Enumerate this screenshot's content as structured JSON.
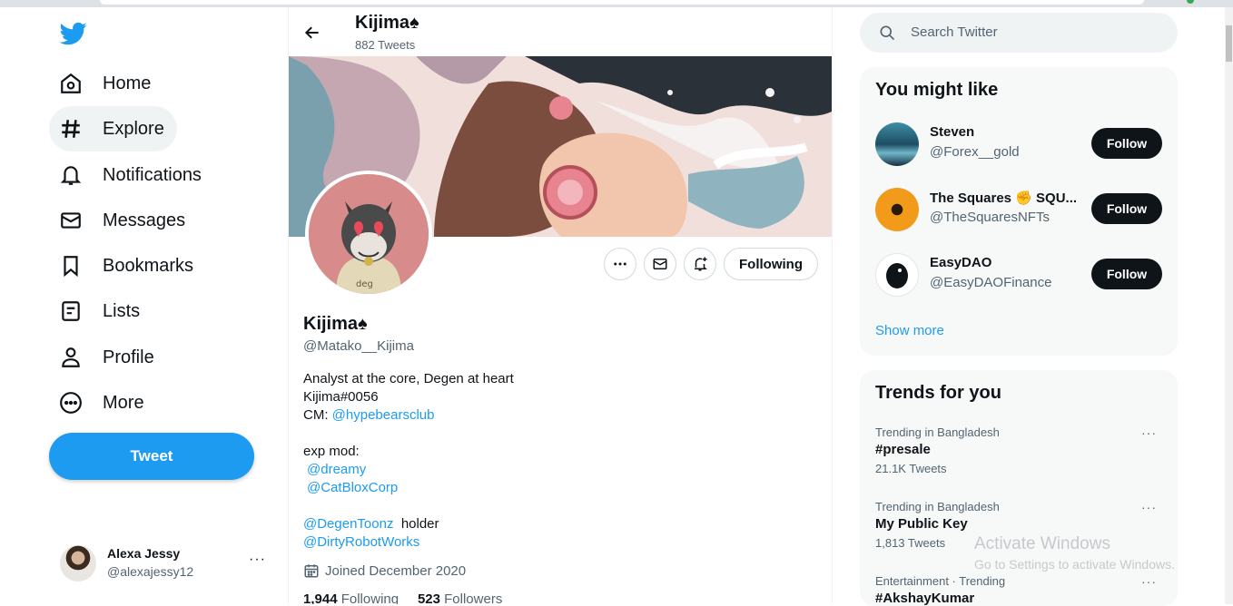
{
  "nav": {
    "items": [
      {
        "label": "Home",
        "icon": "home-icon"
      },
      {
        "label": "Explore",
        "icon": "hashtag-icon"
      },
      {
        "label": "Notifications",
        "icon": "bell-icon"
      },
      {
        "label": "Messages",
        "icon": "envelope-icon"
      },
      {
        "label": "Bookmarks",
        "icon": "bookmark-icon"
      },
      {
        "label": "Lists",
        "icon": "list-icon"
      },
      {
        "label": "Profile",
        "icon": "person-icon"
      },
      {
        "label": "More",
        "icon": "more-circle-icon"
      }
    ],
    "active": "Explore",
    "tweet_label": "Tweet"
  },
  "account": {
    "name": "Alexa Jessy",
    "handle": "@alexajessy12",
    "more": "···"
  },
  "profile_header": {
    "name": "Kijima♠",
    "tweet_count": "882 Tweets"
  },
  "profile": {
    "name": "Kijima♠",
    "handle": "@Matako__Kijima",
    "following_label": "Following",
    "bio": {
      "line1": "Analyst at the core, Degen at heart",
      "line2": "Kijima#0056",
      "line3_prefix": "CM: ",
      "line3_link": "@hypebearsclub",
      "line4": "exp mod:",
      "link_dreamy": "@dreamy",
      "link_catblox": "@CatBloxCorp",
      "link_degentoonz": "@DegenToonz",
      "degentoonz_suffix": "holder",
      "link_dirtyrobot": "@DirtyRobotWorks"
    },
    "joined": "Joined December 2020",
    "following_count": "1,944",
    "following_word": "Following",
    "followers_count": "523",
    "followers_word": "Followers"
  },
  "search": {
    "placeholder": "Search Twitter"
  },
  "suggestions": {
    "title": "You might like",
    "items": [
      {
        "name": "Steven",
        "handle": "@Forex__gold",
        "button": "Follow"
      },
      {
        "name": "The Squares ✊ SQU...",
        "handle": "@TheSquaresNFTs",
        "button": "Follow"
      },
      {
        "name": "EasyDAO",
        "handle": "@EasyDAOFinance",
        "button": "Follow"
      }
    ],
    "show_more": "Show more"
  },
  "trends": {
    "title": "Trends for you",
    "items": [
      {
        "context": "Trending in Bangladesh",
        "topic": "#presale",
        "count": "21.1K Tweets"
      },
      {
        "context": "Trending in Bangladesh",
        "topic": "My Public Key",
        "count": "1,813 Tweets"
      },
      {
        "context": "Entertainment · Trending",
        "topic": "#AkshayKumar",
        "count": ""
      }
    ],
    "more": "···"
  },
  "watermark": {
    "line1": "Activate Windows",
    "line2": "Go to Settings to activate Windows."
  },
  "colors": {
    "accent": "#1d9bf0",
    "text": "#0f1419",
    "muted": "#536471"
  }
}
